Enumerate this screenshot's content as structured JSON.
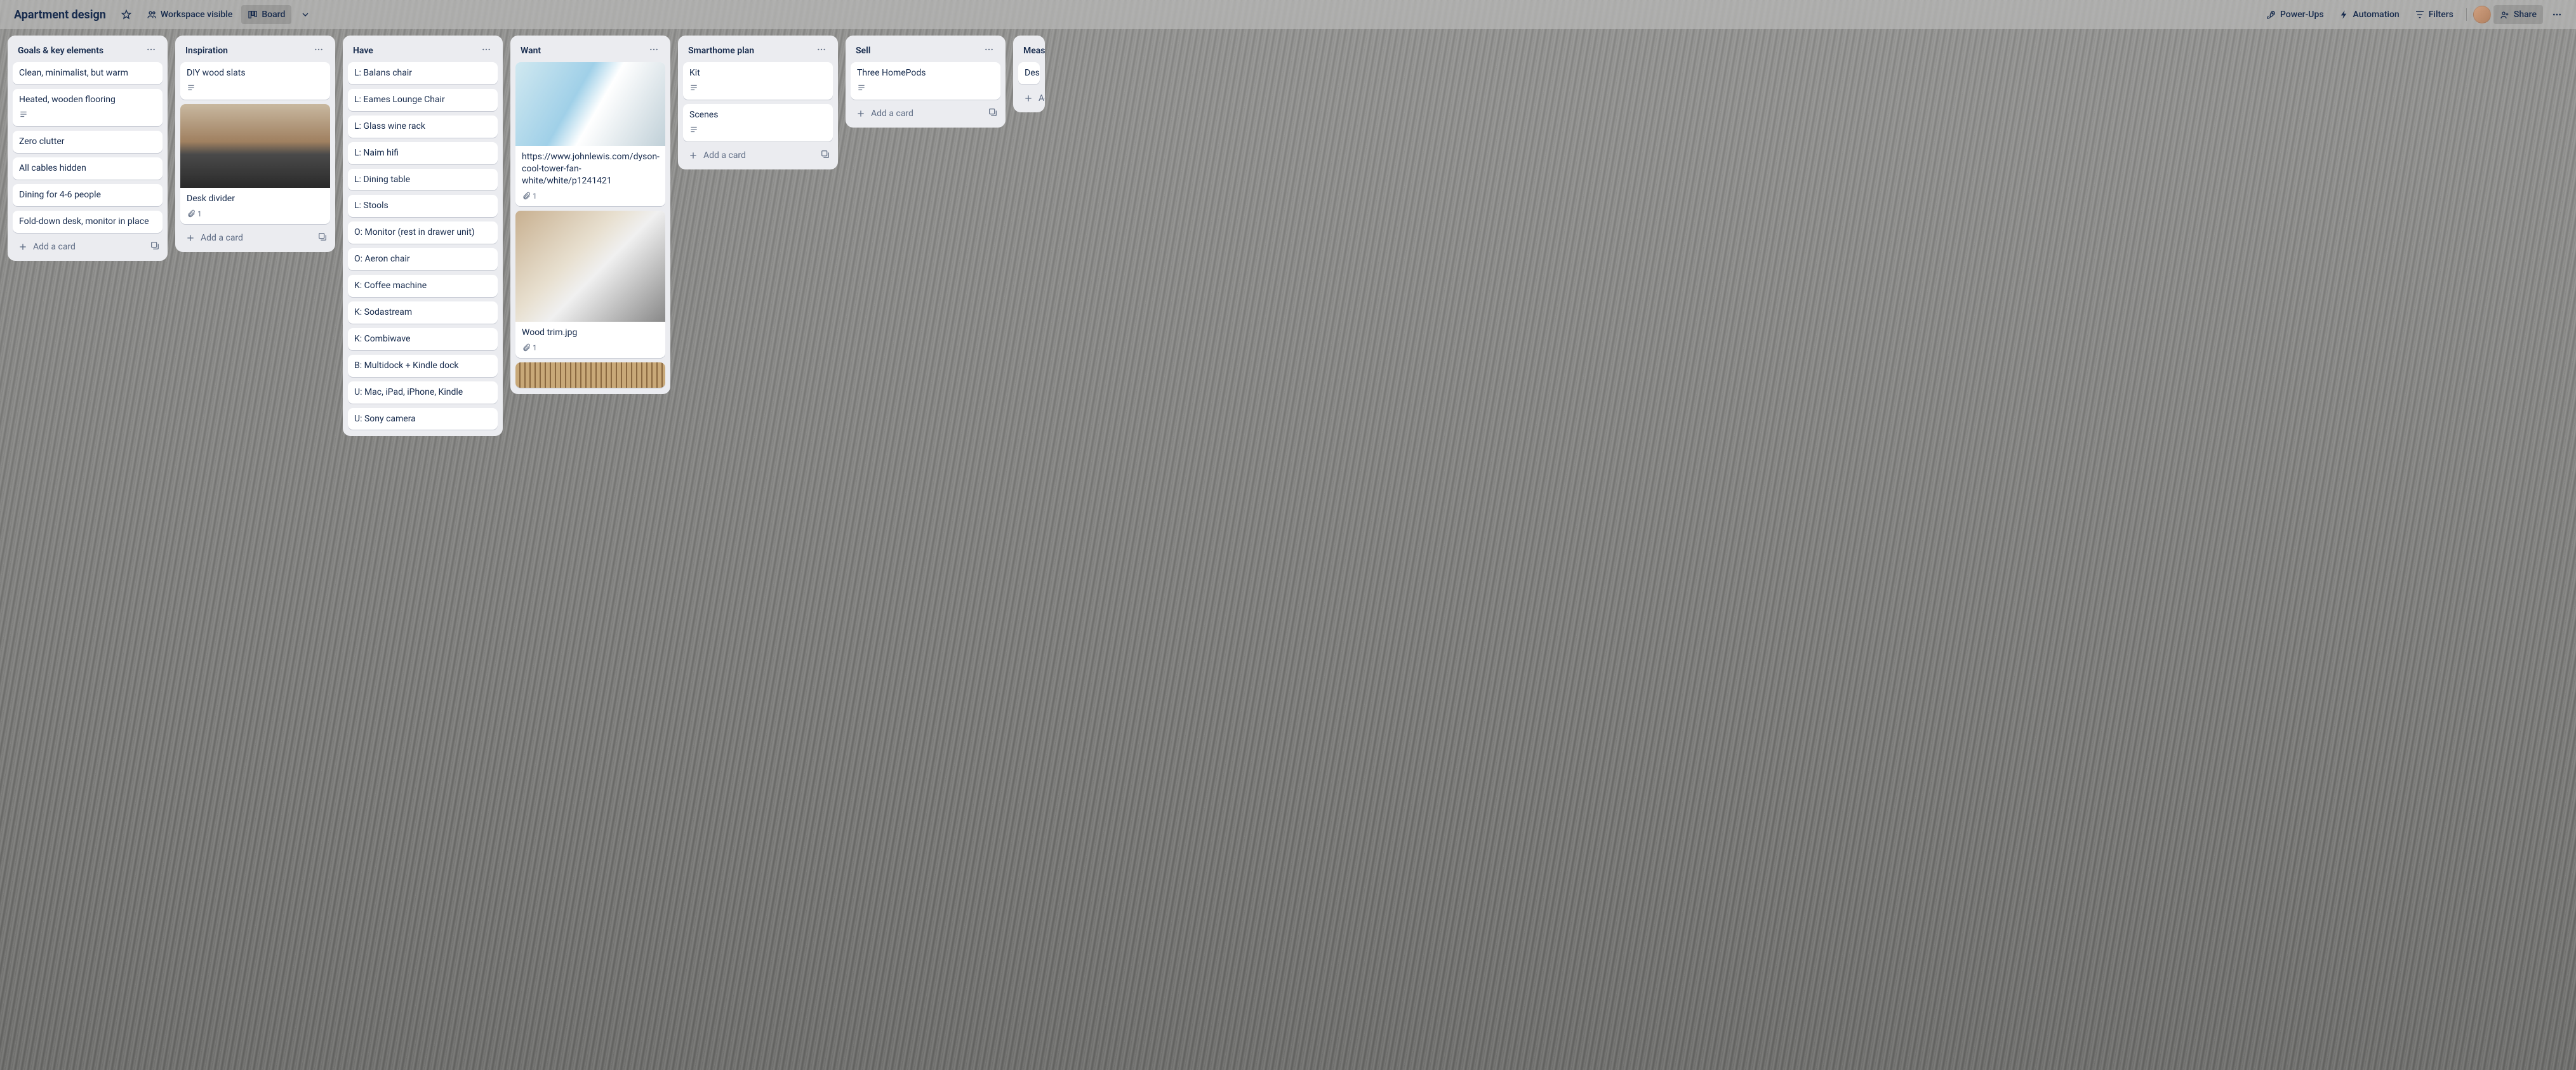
{
  "header": {
    "title": "Apartment design",
    "workspace": "Workspace visible",
    "view": "Board",
    "powerups": "Power-Ups",
    "automation": "Automation",
    "filters": "Filters",
    "share": "Share"
  },
  "addCardLabel": "Add a card",
  "lists": [
    {
      "title": "Goals & key elements",
      "showAdd": true,
      "cards": [
        {
          "text": "Clean, minimalist, but warm"
        },
        {
          "text": "Heated, wooden flooring",
          "desc": true
        },
        {
          "text": "Zero clutter"
        },
        {
          "text": "All cables hidden"
        },
        {
          "text": "Dining for 4-6 people"
        },
        {
          "text": "Fold-down desk, monitor in place"
        }
      ]
    },
    {
      "title": "Inspiration",
      "showAdd": true,
      "cards": [
        {
          "text": "DIY wood slats",
          "desc": true
        },
        {
          "text": "Desk divider",
          "cover": "room",
          "attach": "1"
        }
      ]
    },
    {
      "title": "Have",
      "showAdd": false,
      "cards": [
        {
          "text": "L: Balans chair"
        },
        {
          "text": "L: Eames Lounge Chair"
        },
        {
          "text": "L: Glass wine rack"
        },
        {
          "text": "L: Naim hifi"
        },
        {
          "text": "L: Dining table"
        },
        {
          "text": "L: Stools"
        },
        {
          "text": "O: Monitor (rest in drawer unit)"
        },
        {
          "text": "O: Aeron chair"
        },
        {
          "text": "K: Coffee machine"
        },
        {
          "text": "K: Sodastream"
        },
        {
          "text": "K: Combiwave"
        },
        {
          "text": "B: Multidock + Kindle dock"
        },
        {
          "text": "U: Mac, iPad, iPhone, Kindle"
        },
        {
          "text": "U: Sony camera"
        }
      ]
    },
    {
      "title": "Want",
      "showAdd": false,
      "cards": [
        {
          "text": "https://www.johnlewis.com/dyson-cool-tower-fan-white/white/p1241421",
          "cover": "dyson",
          "attach": "1"
        },
        {
          "text": "Wood trim.jpg",
          "cover": "bedroom",
          "attach": "1"
        },
        {
          "text": "",
          "cover": "slats",
          "partial": true
        }
      ]
    },
    {
      "title": "Smarthome plan",
      "showAdd": true,
      "cards": [
        {
          "text": "Kit",
          "desc": true
        },
        {
          "text": "Scenes",
          "desc": true
        }
      ]
    },
    {
      "title": "Sell",
      "showAdd": true,
      "cards": [
        {
          "text": "Three HomePods",
          "desc": true
        }
      ]
    },
    {
      "title": "Meas",
      "partial": true,
      "showAdd": true,
      "cards": [
        {
          "text": "Desk"
        }
      ],
      "addLabelShort": "Ad"
    }
  ]
}
